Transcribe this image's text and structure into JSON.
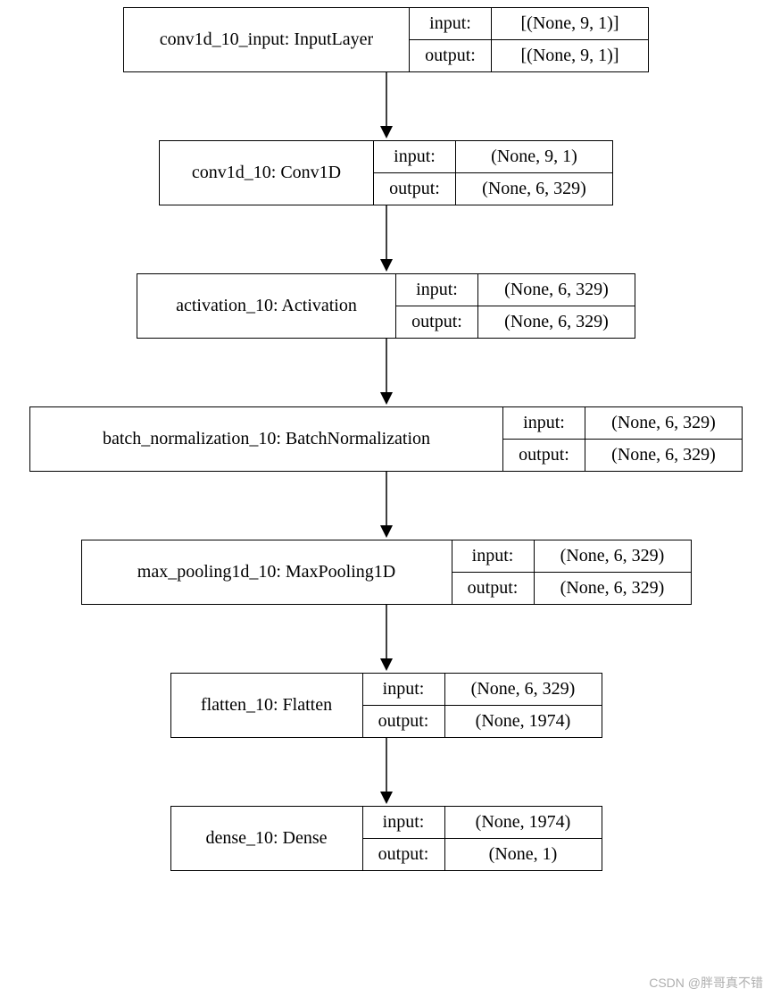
{
  "labels": {
    "input": "input:",
    "output": "output:"
  },
  "watermark": "CSDN @胖哥真不错",
  "nodes": [
    {
      "name": "conv1d_10_input: InputLayer",
      "input": "[(None, 9, 1)]",
      "output": "[(None, 9, 1)]",
      "name_w": 320,
      "label_w": 92,
      "shape_w": 175
    },
    {
      "name": "conv1d_10: Conv1D",
      "input": "(None, 9, 1)",
      "output": "(None, 6, 329)",
      "name_w": 240,
      "label_w": 92,
      "shape_w": 175
    },
    {
      "name": "activation_10: Activation",
      "input": "(None, 6, 329)",
      "output": "(None, 6, 329)",
      "name_w": 290,
      "label_w": 92,
      "shape_w": 175
    },
    {
      "name": "batch_normalization_10: BatchNormalization",
      "input": "(None, 6, 329)",
      "output": "(None, 6, 329)",
      "name_w": 530,
      "label_w": 92,
      "shape_w": 175
    },
    {
      "name": "max_pooling1d_10: MaxPooling1D",
      "input": "(None, 6, 329)",
      "output": "(None, 6, 329)",
      "name_w": 415,
      "label_w": 92,
      "shape_w": 175
    },
    {
      "name": "flatten_10: Flatten",
      "input": "(None, 6, 329)",
      "output": "(None, 1974)",
      "name_w": 215,
      "label_w": 92,
      "shape_w": 175
    },
    {
      "name": "dense_10: Dense",
      "input": "(None, 1974)",
      "output": "(None, 1)",
      "name_w": 215,
      "label_w": 92,
      "shape_w": 175
    }
  ]
}
